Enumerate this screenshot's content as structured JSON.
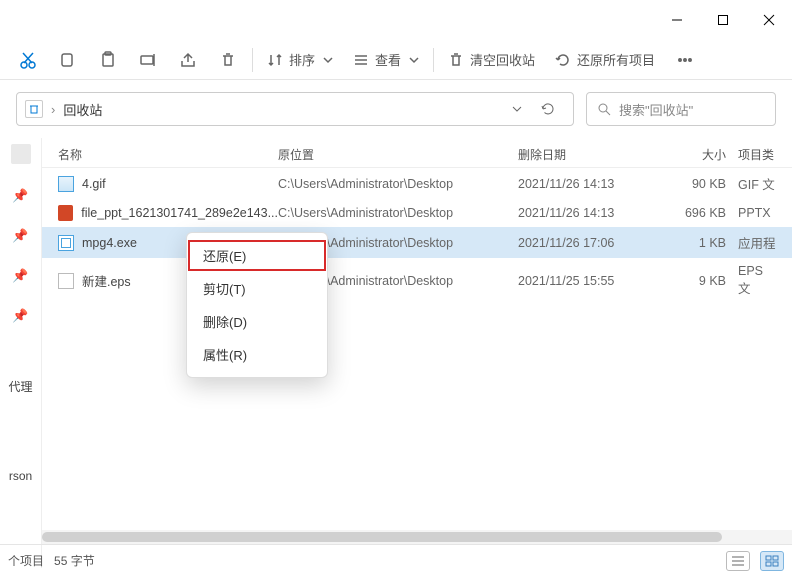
{
  "window": {
    "min": "—",
    "max": "□",
    "close": "✕"
  },
  "toolbar": {
    "sort": "排序",
    "view": "查看",
    "empty": "清空回收站",
    "restoreall": "还原所有项目"
  },
  "breadcrumb": {
    "location": "回收站"
  },
  "search": {
    "placeholder": "搜索\"回收站\""
  },
  "columns": {
    "name": "名称",
    "origloc": "原位置",
    "deldate": "删除日期",
    "size": "大小",
    "type": "项目类"
  },
  "files": [
    {
      "name": "4.gif",
      "icon": "img",
      "loc": "C:\\Users\\Administrator\\Desktop",
      "date": "2021/11/26 14:13",
      "size": "90 KB",
      "type": "GIF 文"
    },
    {
      "name": "file_ppt_1621301741_289e2e143...",
      "icon": "ppt",
      "loc": "C:\\Users\\Administrator\\Desktop",
      "date": "2021/11/26 14:13",
      "size": "696 KB",
      "type": "PPTX"
    },
    {
      "name": "mpg4.exe",
      "icon": "exe",
      "loc": "C:\\Users\\Administrator\\Desktop",
      "date": "2021/11/26 17:06",
      "size": "1 KB",
      "type": "应用程"
    },
    {
      "name": "新建.eps",
      "icon": "eps",
      "loc": "C:\\Users\\Administrator\\Desktop",
      "date": "2021/11/25 15:55",
      "size": "9 KB",
      "type": "EPS 文"
    }
  ],
  "contextmenu": {
    "restore": "还原(E)",
    "cut": "剪切(T)",
    "delete": "删除(D)",
    "props": "属性(R)"
  },
  "leftrail": {
    "label1": "代理",
    "label2": "rson"
  },
  "status": {
    "items": "个项目",
    "bytes": "55 字节"
  }
}
